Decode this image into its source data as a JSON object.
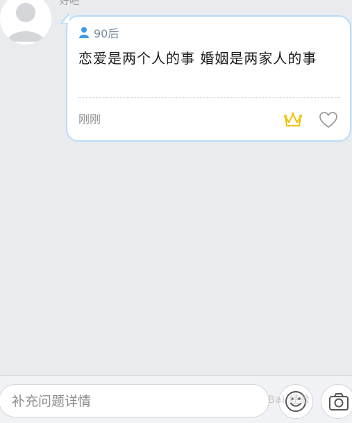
{
  "author": {
    "name": "好吧"
  },
  "post": {
    "age_tag": "90后",
    "question": "恋爱是两个人的事    婚姻是两家人的事",
    "timestamp": "刚刚"
  },
  "composer": {
    "placeholder": "补充问题详情"
  },
  "watermark": {
    "text": "Bai 经验"
  },
  "colors": {
    "background": "#e9ebef",
    "bubble_border": "#b9dcf6",
    "accent_blue": "#3d9be9",
    "crown_yellow": "#f1c40f"
  },
  "icons": {
    "age": "user-icon",
    "crown": "crown-icon",
    "like": "heart-icon",
    "emoji": "smiley-icon",
    "camera": "camera-icon"
  }
}
